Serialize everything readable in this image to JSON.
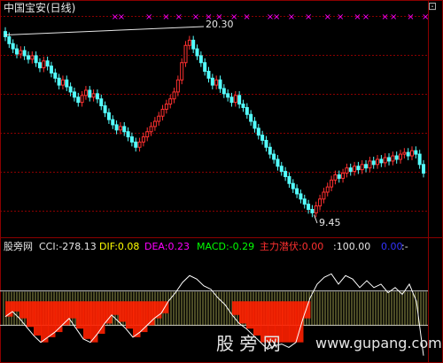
{
  "header": {
    "title": "中国宝安(日线)",
    "menu_glyph": "⊡"
  },
  "price_panel": {
    "max_label": "20.30",
    "min_label": "9.45",
    "signal_glyph": "×"
  },
  "indicator_bar": {
    "name": "股旁网",
    "items": [
      {
        "label": "CCI:",
        "value": "-278.13",
        "color": "#e6e6e6"
      },
      {
        "label": "DIF:",
        "value": "0.08",
        "color": "#ffff00"
      },
      {
        "label": "DEA:",
        "value": "0.23",
        "color": "#ff00ff"
      },
      {
        "label": "MACD:",
        "value": "-0.29",
        "color": "#00ff00"
      },
      {
        "label": "主力潜伏:",
        "value": "0.00",
        "color": "#ff3030"
      },
      {
        "label": ":",
        "value": "100.00",
        "color": "#e6e6e6"
      },
      {
        "label": "",
        "value": "0.00",
        "color": "#3333ff"
      },
      {
        "label": ":",
        "value": "-",
        "color": "#e6e6e6"
      }
    ]
  },
  "watermark": {
    "cn": "股 旁 网",
    "url": "www.gupang.com"
  },
  "colors": {
    "up": "#ff3030",
    "down": "#54ffff",
    "grid": "#8b0000",
    "signal": "#ff00ff",
    "cci": "#ffffff",
    "band": "#ffff80",
    "fill": "#ff2000"
  },
  "chart_data": [
    {
      "type": "candlestick",
      "ylim": [
        9,
        21
      ],
      "close": [
        20.0,
        19.6,
        19.3,
        19.0,
        19.2,
        18.9,
        18.7,
        18.9,
        18.5,
        18.2,
        18.6,
        18.3,
        17.9,
        17.6,
        17.2,
        17.5,
        17.1,
        16.8,
        16.5,
        16.2,
        16.6,
        16.9,
        16.5,
        16.7,
        16.4,
        16.0,
        15.6,
        15.2,
        14.9,
        14.6,
        14.8,
        14.5,
        14.2,
        13.9,
        13.6,
        13.9,
        14.2,
        14.5,
        14.8,
        15.1,
        15.4,
        15.8,
        16.1,
        16.4,
        16.8,
        17.5,
        18.5,
        19.5,
        19.8,
        19.3,
        18.9,
        18.5,
        18.0,
        17.6,
        17.2,
        17.5,
        17.0,
        16.7,
        16.5,
        16.2,
        16.6,
        16.1,
        15.9,
        15.5,
        15.1,
        14.7,
        14.3,
        14.0,
        13.6,
        13.2,
        12.9,
        12.5,
        12.2,
        11.9,
        11.5,
        11.2,
        10.9,
        10.6,
        10.3,
        10.0,
        9.8,
        10.2,
        10.6,
        11.0,
        11.3,
        11.7,
        12.0,
        11.8,
        12.1,
        12.4,
        12.2,
        12.5,
        12.3,
        12.6,
        12.4,
        12.8,
        12.6,
        12.9,
        12.7,
        13.0,
        12.8,
        13.1,
        12.9,
        13.2,
        13.3,
        13.1,
        13.4,
        13.2,
        12.6,
        12.1
      ],
      "signals_at": [
        44,
        47,
        60,
        68,
        74,
        82,
        88,
        93,
        100,
        106,
        117,
        120,
        127,
        135,
        144,
        150,
        158,
        162,
        171,
        175,
        183,
        190
      ]
    },
    {
      "type": "line",
      "name": "CCI",
      "ylim": [
        -300,
        300
      ],
      "values": [
        -50,
        -20,
        -60,
        -110,
        -160,
        -200,
        -170,
        -140,
        -100,
        -60,
        -120,
        -180,
        -200,
        -150,
        -90,
        -40,
        -80,
        -120,
        -170,
        -140,
        -100,
        -60,
        -30,
        40,
        90,
        150,
        190,
        170,
        130,
        110,
        60,
        20,
        -40,
        -90,
        -120,
        -160,
        -200,
        -240,
        -220,
        -210,
        -230,
        -200,
        -60,
        60,
        140,
        180,
        200,
        140,
        190,
        170,
        120,
        160,
        120,
        140,
        90,
        120,
        80,
        140,
        40,
        -278
      ]
    }
  ]
}
